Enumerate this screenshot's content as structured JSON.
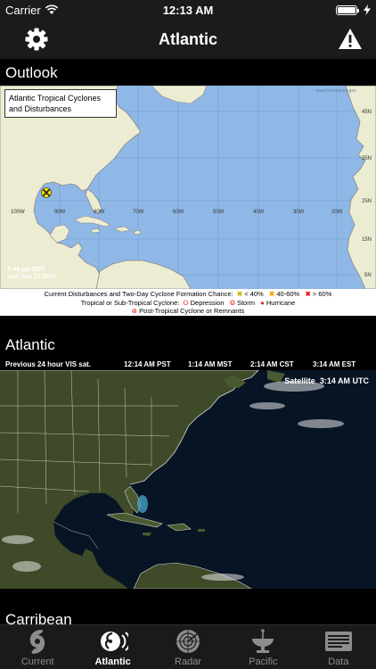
{
  "status_bar": {
    "carrier": "Carrier",
    "time": "12:13 AM"
  },
  "nav": {
    "title": "Atlantic",
    "left_icon": "gear-icon",
    "right_icon": "warning-icon"
  },
  "sections": {
    "outlook": "Outlook",
    "atlantic": "Atlantic",
    "carribean": "Carribean"
  },
  "outlook_map": {
    "title_line1": "Atlantic Tropical Cyclones",
    "title_line2": "and Disturbances",
    "watermark": "www.hurricanes.gov",
    "stamp_time": "7:48 pm EDT",
    "stamp_date": "Sun Jun 17 2018",
    "lat_labels": [
      "45N",
      "35N",
      "25N",
      "15N",
      "5N"
    ],
    "lon_labels": [
      "100W",
      "90W",
      "80W",
      "70W",
      "60W",
      "50W",
      "40W",
      "30W",
      "20W"
    ],
    "legend_line1_label": "Current Disturbances and Two-Day Cyclone Formation Chance:",
    "legend_low": "< 40%",
    "legend_mid": "40-60%",
    "legend_high": "> 60%",
    "legend_line2_label": "Tropical or Sub-Tropical Cyclone:",
    "legend_depression": "Depression",
    "legend_storm": "Storm",
    "legend_hurricane": "Hurricane",
    "legend_post": "Post-Tropical Cyclone or Remnants",
    "colors": {
      "low": "#f5e400",
      "mid": "#f5a300",
      "high": "#e41a1a"
    }
  },
  "satellite": {
    "caption": "Previous 24 hour VIS sat.",
    "times": [
      "12:14 AM PST",
      "1:14 AM MST",
      "2:14 AM CST",
      "3:14 AM EST"
    ],
    "label": "Satellite  3:14 AM UTC"
  },
  "tabs": [
    {
      "label": "Current",
      "icon": "hurricane-icon",
      "active": false
    },
    {
      "label": "Atlantic",
      "icon": "atlantic-storm-icon",
      "active": true
    },
    {
      "label": "Radar",
      "icon": "radar-icon",
      "active": false
    },
    {
      "label": "Pacific",
      "icon": "satellite-dish-icon",
      "active": false
    },
    {
      "label": "Data",
      "icon": "data-card-icon",
      "active": false
    }
  ]
}
